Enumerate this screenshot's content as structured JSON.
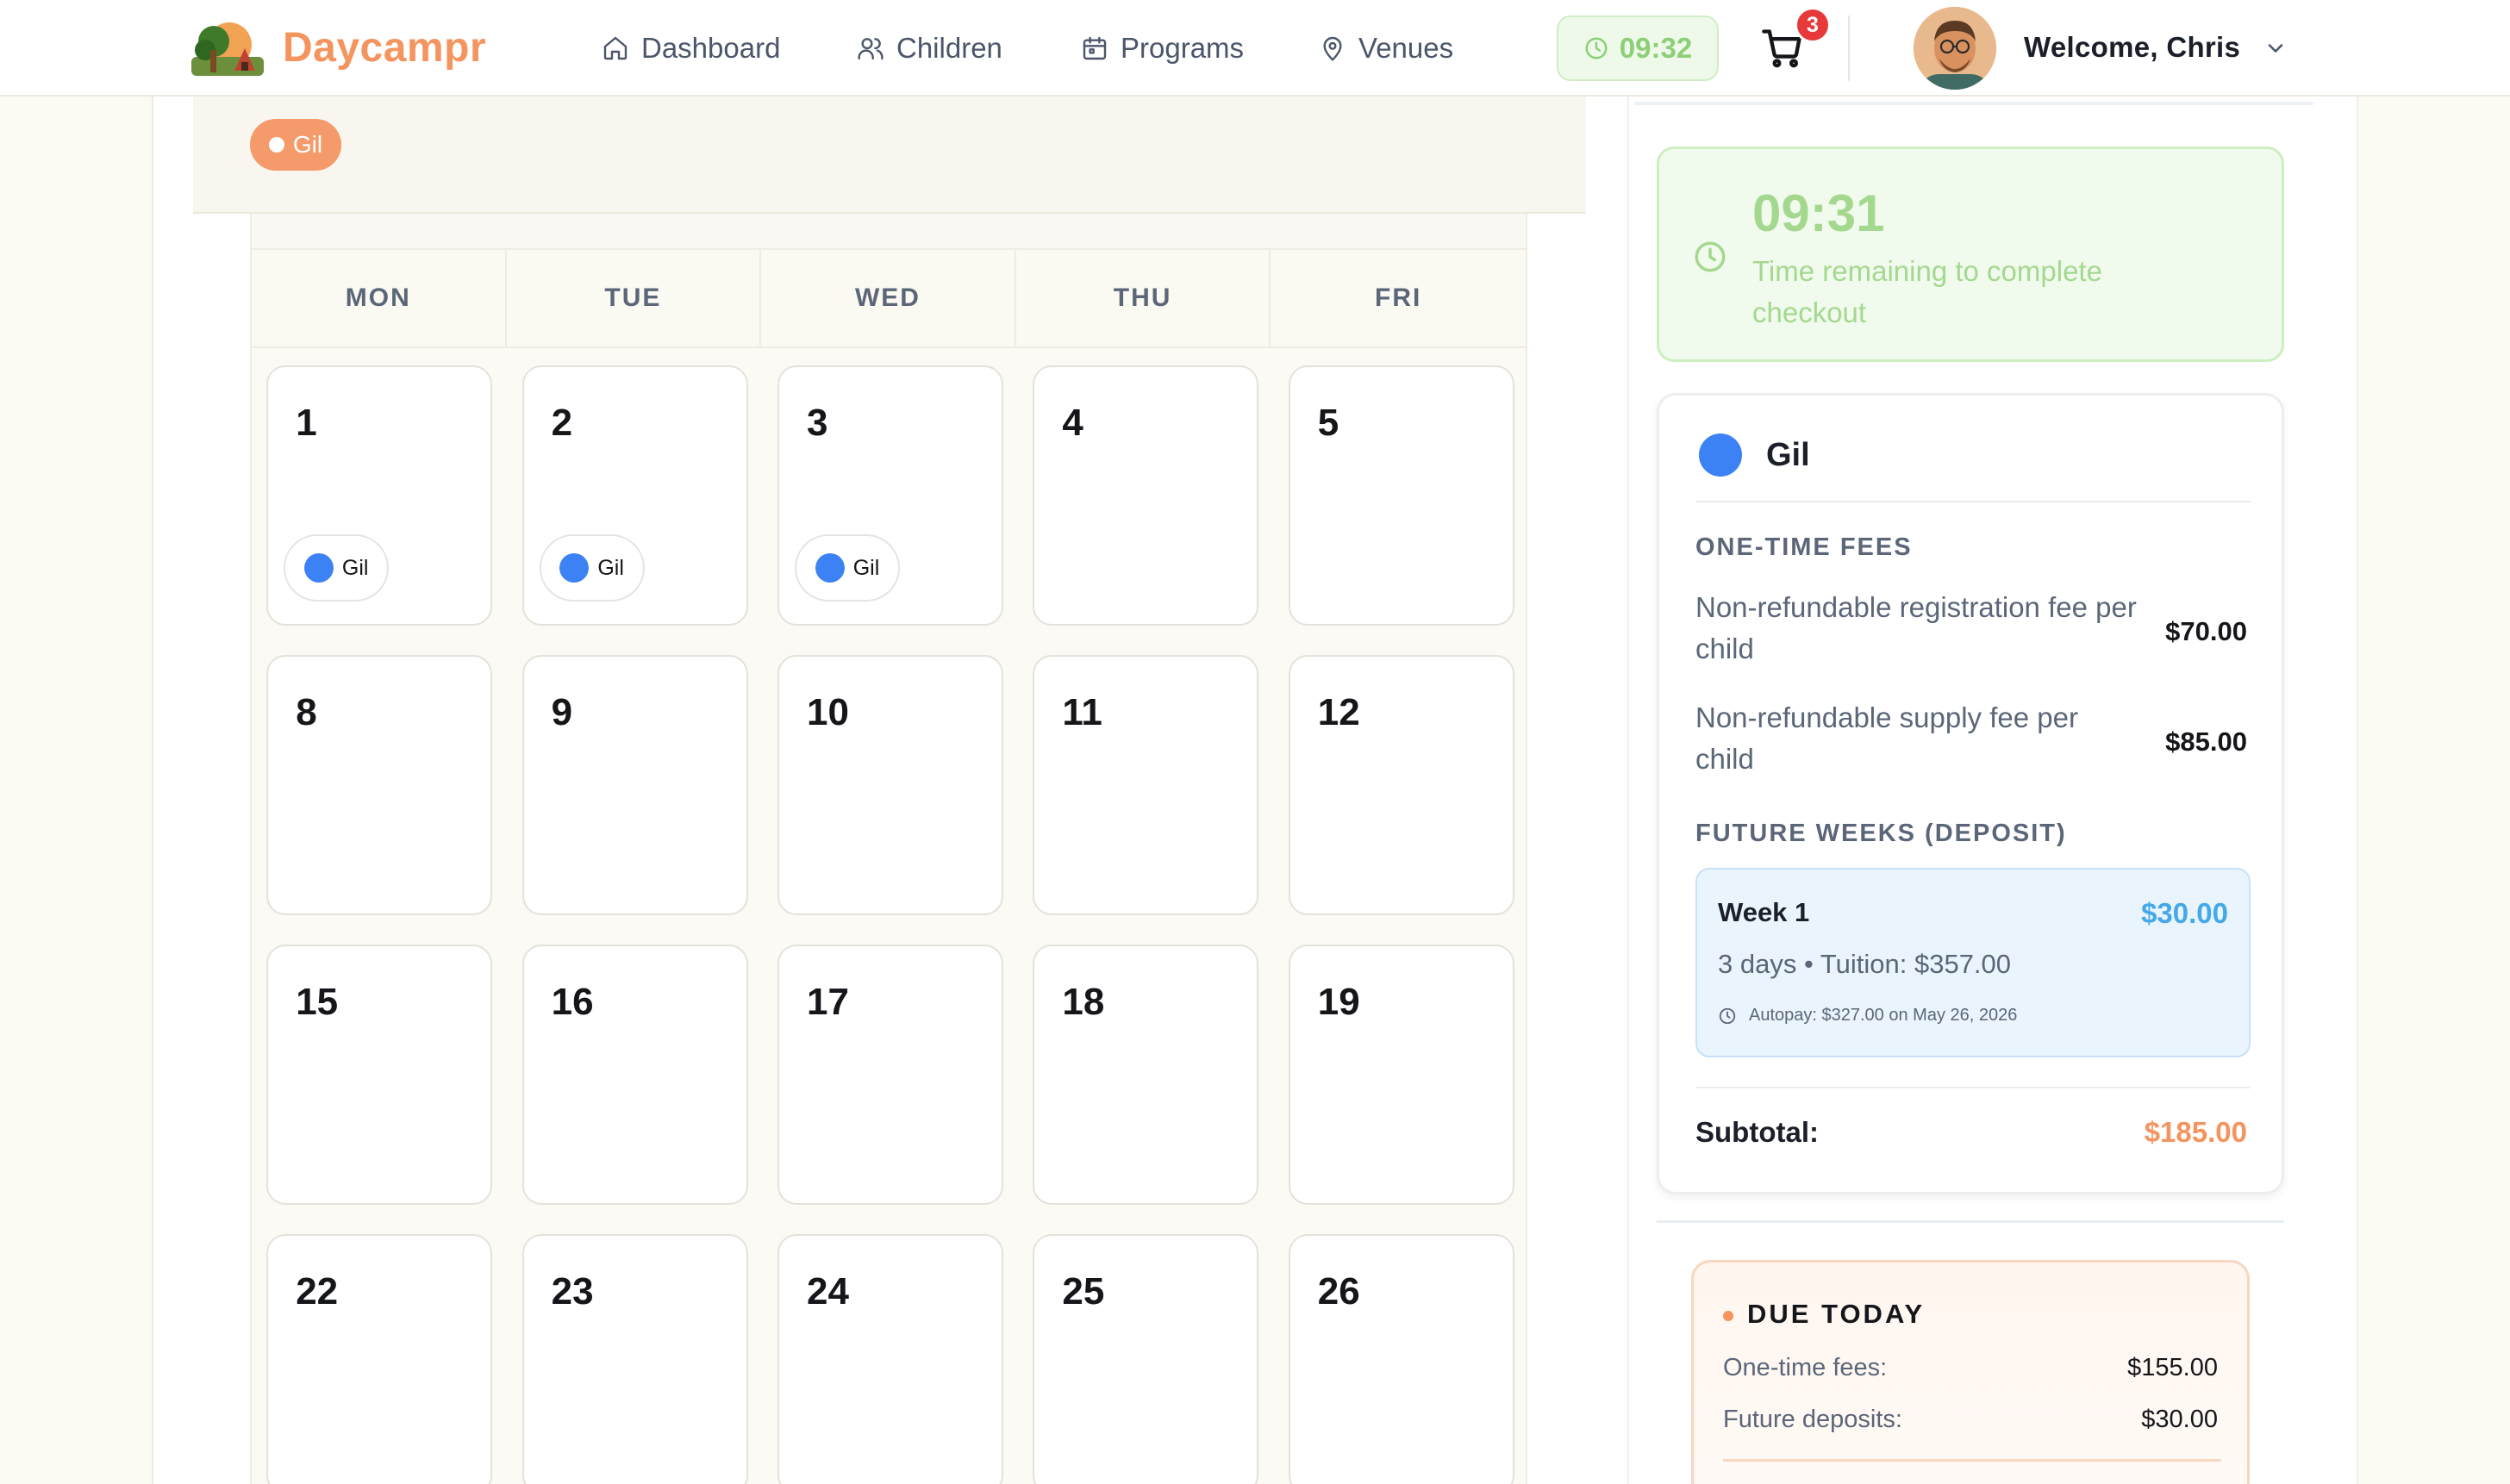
{
  "header": {
    "brand": "Daycampr",
    "nav": [
      {
        "label": "Dashboard",
        "icon": "home-icon"
      },
      {
        "label": "Children",
        "icon": "users-icon"
      },
      {
        "label": "Programs",
        "icon": "calendar-icon"
      },
      {
        "label": "Venues",
        "icon": "map-pin-icon"
      }
    ],
    "timer": "09:32",
    "cart_count": "3",
    "welcome": "Welcome, Chris"
  },
  "filter": {
    "chips": [
      {
        "label": "Gil",
        "color": "#f59a6a"
      }
    ]
  },
  "calendar": {
    "weekdays": [
      "MON",
      "TUE",
      "WED",
      "THU",
      "FRI"
    ],
    "weeks": [
      [
        "1",
        "2",
        "3",
        "4",
        "5"
      ],
      [
        "8",
        "9",
        "10",
        "11",
        "12"
      ],
      [
        "15",
        "16",
        "17",
        "18",
        "19"
      ],
      [
        "22",
        "23",
        "24",
        "25",
        "26"
      ]
    ],
    "event_label": "Gil",
    "event_color": "#3c82f5"
  },
  "summary": {
    "countdown_time": "09:31",
    "countdown_text": "Time remaining to complete checkout",
    "child": {
      "name": "Gil",
      "color": "#3c82f5",
      "one_time_title": "ONE-TIME FEES",
      "fees": [
        {
          "label": "Non-refundable registration fee per child",
          "amount": "$70.00"
        },
        {
          "label": "Non-refundable supply fee per child",
          "amount": "$85.00"
        }
      ],
      "future_title": "FUTURE WEEKS (DEPOSIT)",
      "week": {
        "title": "Week 1",
        "amount": "$30.00",
        "desc": "3 days • Tuition: $357.00",
        "autopay": "Autopay: $327.00 on May 26, 2026"
      },
      "subtotal_label": "Subtotal:",
      "subtotal": "$185.00"
    },
    "due": {
      "title": "DUE TODAY",
      "one_time_label": "One-time fees:",
      "one_time_amount": "$155.00",
      "deposits_label": "Future deposits:",
      "deposits_amount": "$30.00"
    }
  }
}
